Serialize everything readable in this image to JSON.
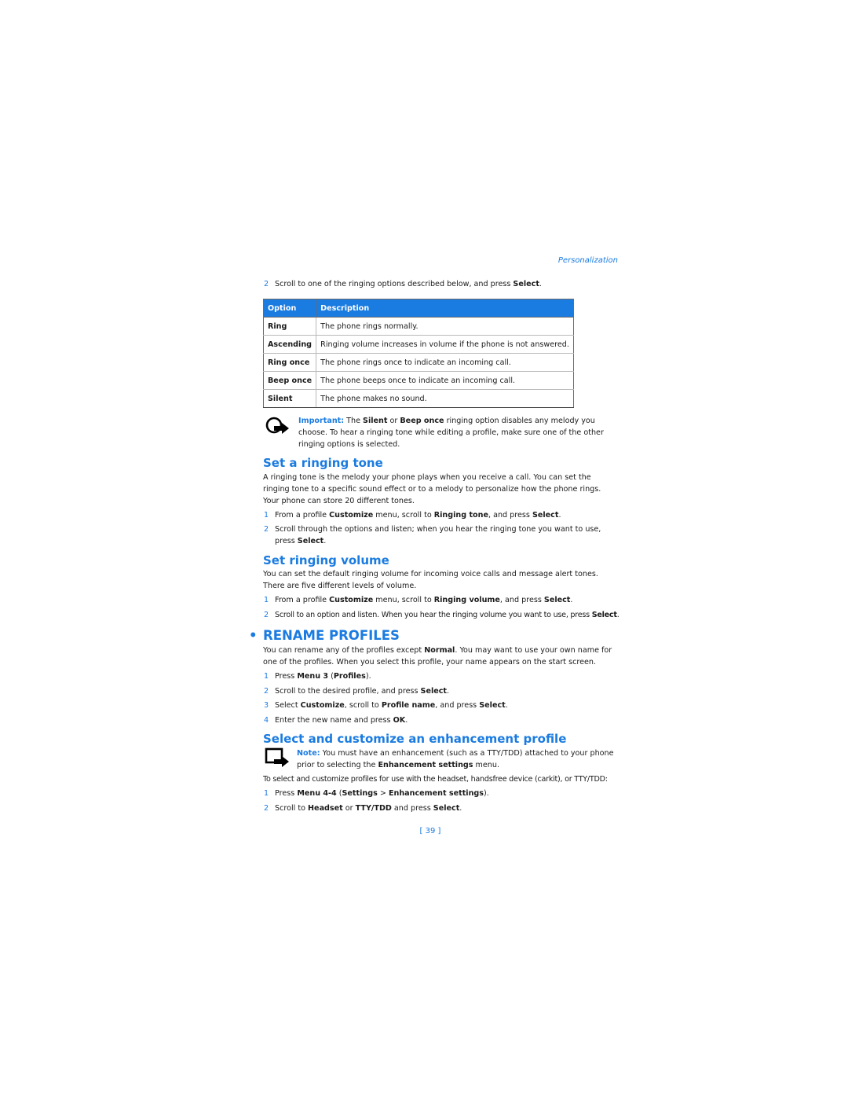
{
  "running_head": "Personalization",
  "intro_step": {
    "num": "2",
    "pre": "Scroll to one of the ringing options described below, and press ",
    "bold": "Select",
    "post": "."
  },
  "table": {
    "headers": [
      "Option",
      "Description"
    ],
    "rows": [
      {
        "option": "Ring",
        "description": "The phone rings normally."
      },
      {
        "option": "Ascending",
        "description": "Ringing volume increases in volume if the phone is not answered."
      },
      {
        "option": "Ring once",
        "description": "The phone rings once to indicate an incoming call."
      },
      {
        "option": "Beep once",
        "description": "The phone beeps once to indicate an incoming call."
      },
      {
        "option": "Silent",
        "description": "The phone makes no sound."
      }
    ]
  },
  "important": {
    "label": "Important:",
    "t1": " The ",
    "b1": "Silent",
    "t2": " or ",
    "b2": "Beep once",
    "t3": " ringing option disables any melody you choose. To hear a ringing tone while editing a profile, make sure one of the other ringing options is selected.",
    "icon": "important-icon"
  },
  "ringing_tone": {
    "heading": "Set a ringing tone",
    "body": "A ringing tone is the melody your phone plays when you receive a call. You can set the ringing tone to a specific sound effect or to a melody to personalize how the phone rings. Your phone can store 20 different tones.",
    "steps": [
      {
        "num": "1",
        "a": "From a profile ",
        "b1": "Customize",
        "c": " menu, scroll to ",
        "b2": "Ringing tone",
        "d": ", and press ",
        "b3": "Select",
        "e": "."
      },
      {
        "num": "2",
        "a": "Scroll through the options and listen; when you hear the ringing tone you want to use, press ",
        "b1": "Select",
        "e": "."
      }
    ]
  },
  "ringing_volume": {
    "heading": "Set ringing volume",
    "body": "You can set the default ringing volume for incoming voice calls and message alert tones. There are five different levels of volume.",
    "steps": [
      {
        "num": "1",
        "a": "From a profile ",
        "b1": "Customize",
        "c": " menu, scroll to ",
        "b2": "Ringing volume",
        "d": ", and press ",
        "b3": "Select",
        "e": "."
      },
      {
        "num": "2",
        "a": "Scroll to an option and listen. When you hear the ringing volume you want to use, press ",
        "b1": "Select",
        "e": "."
      }
    ]
  },
  "rename": {
    "bullet": "•",
    "heading": "RENAME PROFILES",
    "body_a": "You can rename any of the profiles except ",
    "body_b": "Normal",
    "body_c": ". You may want to use your own name for one of the profiles. When you select this profile, your name appears on the start screen.",
    "steps": [
      {
        "num": "1",
        "a": "Press ",
        "b1": "Menu 3",
        "c": " (",
        "b2": "Profiles",
        "d": ")."
      },
      {
        "num": "2",
        "a": "Scroll to the desired profile, and press ",
        "b1": "Select",
        "c": "."
      },
      {
        "num": "3",
        "a": "Select ",
        "b1": "Customize",
        "c": ", scroll to ",
        "b2": "Profile name",
        "d": ", and press ",
        "b3": "Select",
        "e": "."
      },
      {
        "num": "4",
        "a": "Enter the new name and press ",
        "b1": "OK",
        "c": "."
      }
    ]
  },
  "enhancement": {
    "heading": "Select and customize an enhancement profile",
    "note_label": "Note:",
    "note_a": "  You must have an enhancement (such as a TTY/TDD) attached to your phone prior to selecting the ",
    "note_b": "Enhancement settings",
    "note_c": " menu.",
    "body": "To select and customize profiles for use with the headset, handsfree device (carkit), or TTY/TDD:",
    "steps": [
      {
        "num": "1",
        "a": "Press ",
        "b1": "Menu 4-4",
        "c": " (",
        "b2": "Settings",
        "d": " > ",
        "b3": "Enhancement settings",
        "e": ")."
      },
      {
        "num": "2",
        "a": "Scroll to ",
        "b1": "Headset",
        "c": " or ",
        "b2": "TTY/TDD",
        "d": " and press ",
        "b3": "Select",
        "e": "."
      }
    ]
  },
  "page_number": "[ 39 ]"
}
